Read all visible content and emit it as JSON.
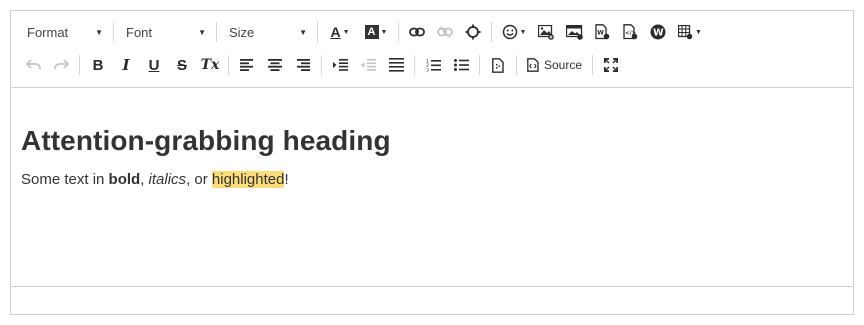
{
  "toolbar": {
    "format_label": "Format",
    "font_label": "Font",
    "size_label": "Size",
    "source_label": "Source",
    "text_color_glyph": "A",
    "bg_color_glyph": "A",
    "bold_glyph": "B",
    "italic_glyph": "I",
    "underline_glyph": "U",
    "strike_glyph": "S",
    "clear_format_glyph": "Tx"
  },
  "content": {
    "heading": "Attention-grabbing heading",
    "para_prefix": "Some text in ",
    "bold_text": "bold",
    "sep1": ", ",
    "italic_text": "italics",
    "sep2": ", or ",
    "highlight_text": "highlighted",
    "suffix": "!"
  },
  "colors": {
    "highlight": "#fbdd7c",
    "border": "#d1d1d1",
    "disabled_icon": "#c4c4c4"
  }
}
